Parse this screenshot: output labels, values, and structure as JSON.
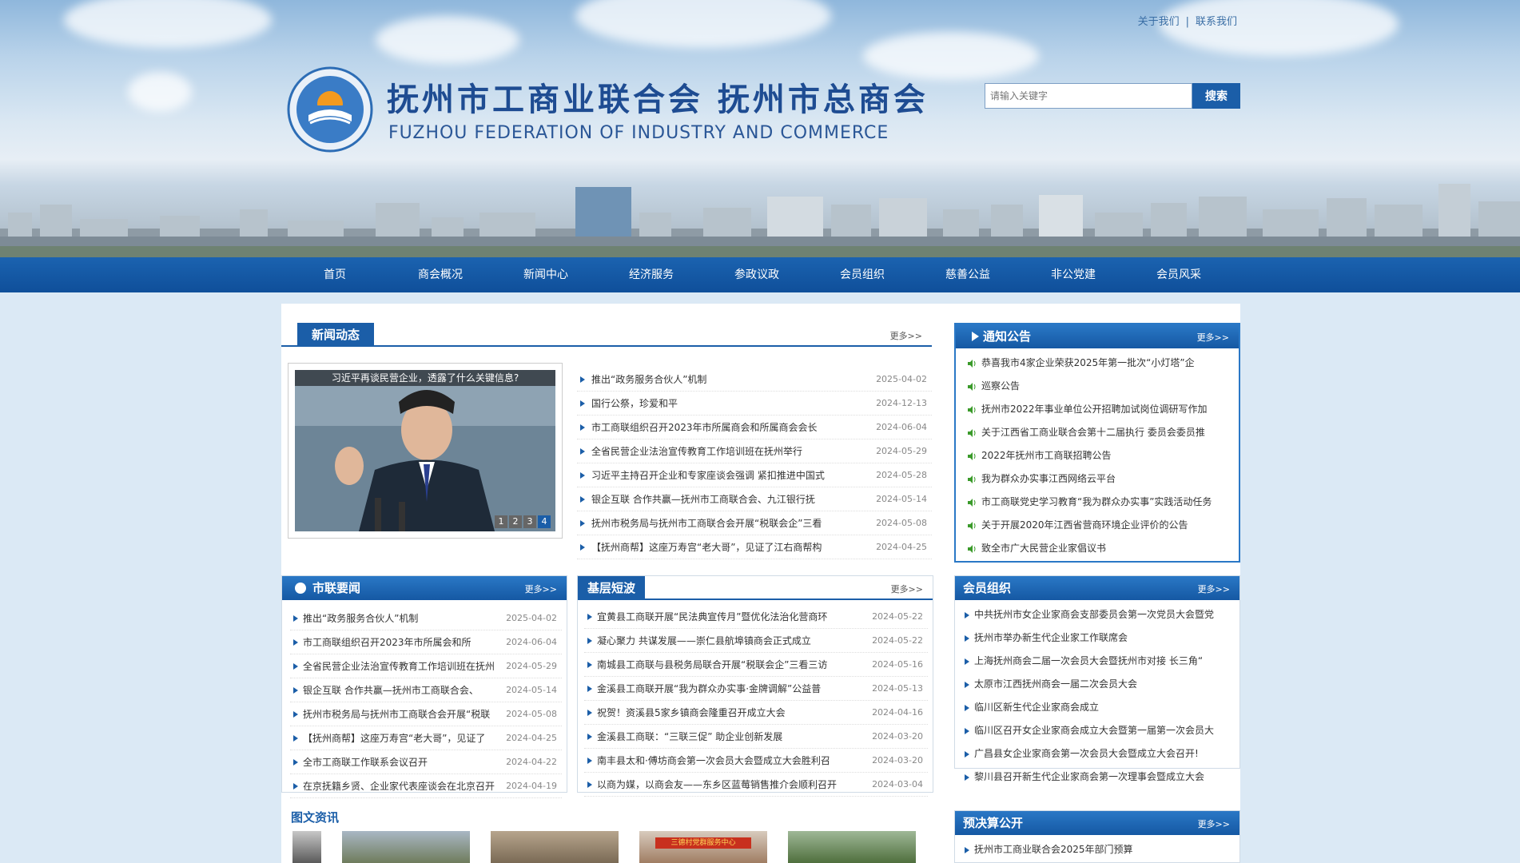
{
  "header": {
    "top_links": [
      "关于我们",
      "联系我们"
    ],
    "title_cn": "抚州市工商业联合会  抚州市总商会",
    "title_en": "FUZHOU FEDERATION OF INDUSTRY AND COMMERCE",
    "search_placeholder": "请输入关键字",
    "search_button": "搜索"
  },
  "nav": [
    "首页",
    "商会概况",
    "新闻中心",
    "经济服务",
    "参政议政",
    "会员组织",
    "慈善公益",
    "非公党建",
    "会员风采"
  ],
  "news": {
    "tab": "新闻动态",
    "more": "更多>>",
    "photo_caption": "习近平再谈民营企业，透露了什么关键信息?",
    "slide_numbers": [
      "1",
      "2",
      "3",
      "4"
    ],
    "items": [
      {
        "title": "推出“政务服务合伙人”机制",
        "date": "2025-04-02"
      },
      {
        "title": "国行公祭，珍爱和平",
        "date": "2024-12-13"
      },
      {
        "title": "市工商联组织召开2023年市所属商会和所属商会会长",
        "date": "2024-06-04"
      },
      {
        "title": "全省民营企业法治宣传教育工作培训班在抚州举行",
        "date": "2024-05-29"
      },
      {
        "title": "习近平主持召开企业和专家座谈会强调 紧扣推进中国式",
        "date": "2024-05-28"
      },
      {
        "title": "银企互联 合作共赢—抚州市工商联合会、九江银行抚",
        "date": "2024-05-14"
      },
      {
        "title": "抚州市税务局与抚州市工商联合会开展“税联会企”三看",
        "date": "2024-05-08"
      },
      {
        "title": "【抚州商帮】这座万寿宫“老大哥”，见证了江右商帮构",
        "date": "2024-04-25"
      }
    ]
  },
  "notice": {
    "title": "通知公告",
    "more": "更多>>",
    "items": [
      "恭喜我市4家企业荣获2025年第一批次“小灯塔”企",
      "巡察公告",
      "抚州市2022年事业单位公开招聘加试岗位调研写作加",
      "关于江西省工商业联合会第十二届执行 委员会委员推",
      "2022年抚州市工商联招聘公告",
      "我为群众办实事江西网络云平台",
      "市工商联党史学习教育“我为群众办实事”实践活动任务",
      "关于开展2020年江西省营商环境企业评价的公告",
      "致全市广大民营企业家倡议书"
    ]
  },
  "shilian": {
    "title": "市联要闻",
    "more": "更多>>",
    "items": [
      {
        "title": "推出“政务服务合伙人”机制",
        "date": "2025-04-02"
      },
      {
        "title": "市工商联组织召开2023年市所属会和所",
        "date": "2024-06-04"
      },
      {
        "title": "全省民营企业法治宣传教育工作培训班在抚州",
        "date": "2024-05-29"
      },
      {
        "title": "银企互联 合作共赢—抚州市工商联合会、",
        "date": "2024-05-14"
      },
      {
        "title": "抚州市税务局与抚州市工商联合会开展“税联",
        "date": "2024-05-08"
      },
      {
        "title": "【抚州商帮】这座万寿宫“老大哥”，见证了",
        "date": "2024-04-25"
      },
      {
        "title": "全市工商联工作联系会议召开",
        "date": "2024-04-22"
      },
      {
        "title": "在京抚籍乡贤、企业家代表座谈会在北京召开",
        "date": "2024-04-19"
      }
    ]
  },
  "jiceng": {
    "title": "基层短波",
    "more": "更多>>",
    "items": [
      {
        "title": "宜黄县工商联开展“民法典宣传月”暨优化法治化营商环",
        "date": "2024-05-22"
      },
      {
        "title": "凝心聚力 共谋发展——崇仁县航埠镇商会正式成立",
        "date": "2024-05-22"
      },
      {
        "title": "南城县工商联与县税务局联合开展“税联会企”三看三访",
        "date": "2024-05-16"
      },
      {
        "title": "金溪县工商联开展“我为群众办实事·金牌调解”公益普",
        "date": "2024-05-13"
      },
      {
        "title": "祝贺！资溪县5家乡镇商会隆重召开成立大会",
        "date": "2024-04-16"
      },
      {
        "title": "金溪县工商联：“三联三促” 助企业创新发展",
        "date": "2024-03-20"
      },
      {
        "title": "南丰县太和·傅坊商会第一次会员大会暨成立大会胜利召",
        "date": "2024-03-20"
      },
      {
        "title": "以商为媒，以商会友——东乡区蓝莓销售推介会顺利召开",
        "date": "2024-03-04"
      }
    ]
  },
  "member": {
    "title": "会员组织",
    "more": "更多>>",
    "items": [
      "中共抚州市女企业家商会支部委员会第一次党员大会暨党",
      "抚州市举办新生代企业家工作联席会",
      "上海抚州商会二届一次会员大会暨抚州市对接 长三角“",
      "太原市江西抚州商会一届二次会员大会",
      "临川区新生代企业家商会成立",
      "临川区召开女企业家商会成立大会暨第一届第一次会员大",
      "广昌县女企业家商会第一次会员大会暨成立大会召开!",
      "黎川县召开新生代企业家商会第一次理事会暨成立大会"
    ]
  },
  "budget": {
    "title": "预决算公开",
    "more": "更多>>",
    "items": [
      "抚州市工商业联合会2025年部门预算"
    ]
  },
  "photo_news": {
    "title": "图文资讯",
    "thumb_caption": "三德村党群服务中心"
  }
}
